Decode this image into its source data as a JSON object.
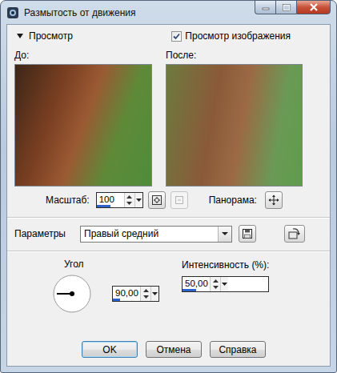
{
  "window": {
    "title": "Размытость от движения"
  },
  "preview": {
    "label": "Просмотр",
    "expanded": true,
    "show_image": {
      "label": "Просмотр изображения",
      "checked": true
    }
  },
  "before": {
    "label": "До:"
  },
  "after": {
    "label": "После:"
  },
  "zoom": {
    "label": "Масштаб:",
    "value": "100",
    "level": 0.5
  },
  "zoom_tools": [
    {
      "name": "fit",
      "disabled": false
    },
    {
      "name": "actual",
      "disabled": true
    }
  ],
  "pan": {
    "label": "Панорама:"
  },
  "params": {
    "label": "Параметры",
    "preset": "Правый средний"
  },
  "angle": {
    "label": "Угол",
    "value": "90,00",
    "level": 0.25,
    "degrees": 90
  },
  "intensity": {
    "label": "Интенсивность (%):",
    "value": "50,00",
    "level": 0.5
  },
  "buttons": [
    {
      "label": "OK"
    },
    {
      "label": "Отмена"
    },
    {
      "label": "Справка"
    }
  ]
}
